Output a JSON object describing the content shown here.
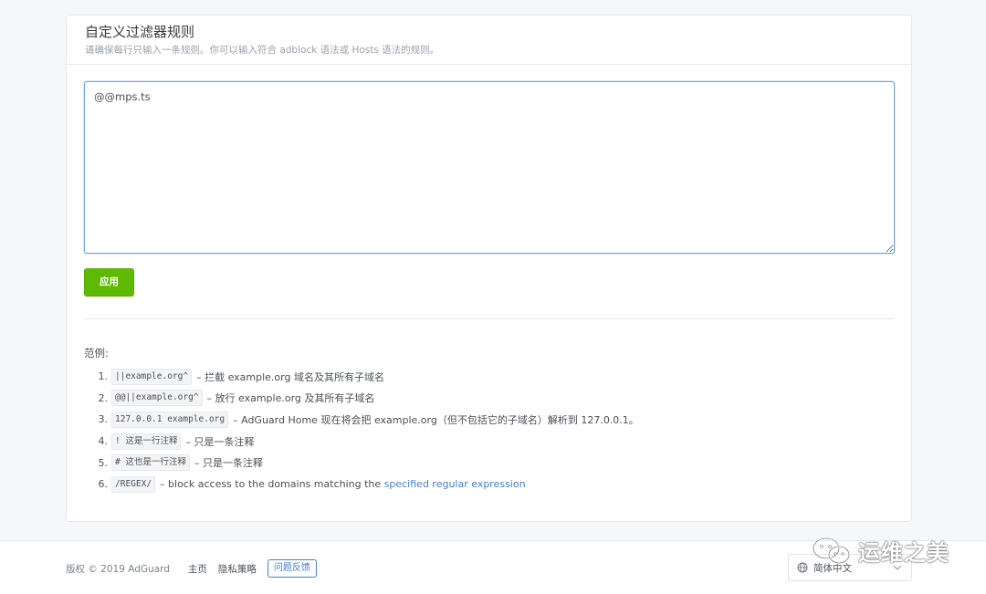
{
  "card": {
    "title": "自定义过滤器规则",
    "subtitle": "请确保每行只输入一条规则。你可以输入符合 adblock 语法或 Hosts 语法的规则。"
  },
  "rules_textarea": {
    "value": "@@mps.ts"
  },
  "apply_button": {
    "label": "应用"
  },
  "examples": {
    "title": "范例:",
    "items": [
      {
        "num": "1.",
        "code": "||example.org^",
        "desc": "– 拦截 example.org 域名及其所有子域名"
      },
      {
        "num": "2.",
        "code": "@@||example.org^",
        "desc": "– 放行 example.org 及其所有子域名"
      },
      {
        "num": "3.",
        "code": "127.0.0.1 example.org",
        "desc": "– AdGuard Home 现在将会把 example.org（但不包括它的子域名）解析到 127.0.0.1。"
      },
      {
        "num": "4.",
        "code": "! 这是一行注释",
        "desc": "– 只是一条注释"
      },
      {
        "num": "5.",
        "code": "# 这也是一行注释",
        "desc": "– 只是一条注释"
      },
      {
        "num": "6.",
        "code": "/REGEX/",
        "desc": "– block access to the domains matching the ",
        "link": "specified regular expression"
      }
    ]
  },
  "footer": {
    "copyright": "版权 © 2019 AdGuard",
    "links": {
      "home": "主页",
      "privacy": "隐私策略"
    },
    "feedback_button": "问题反馈",
    "language": {
      "selected": "简体中文",
      "icon": "globe-icon"
    }
  },
  "watermark": {
    "text": "运维之美",
    "icon": "wechat-icon"
  },
  "colors": {
    "accent_green": "#5eba00",
    "link_blue": "#467fcf",
    "page_background": "#f5f7fb"
  }
}
